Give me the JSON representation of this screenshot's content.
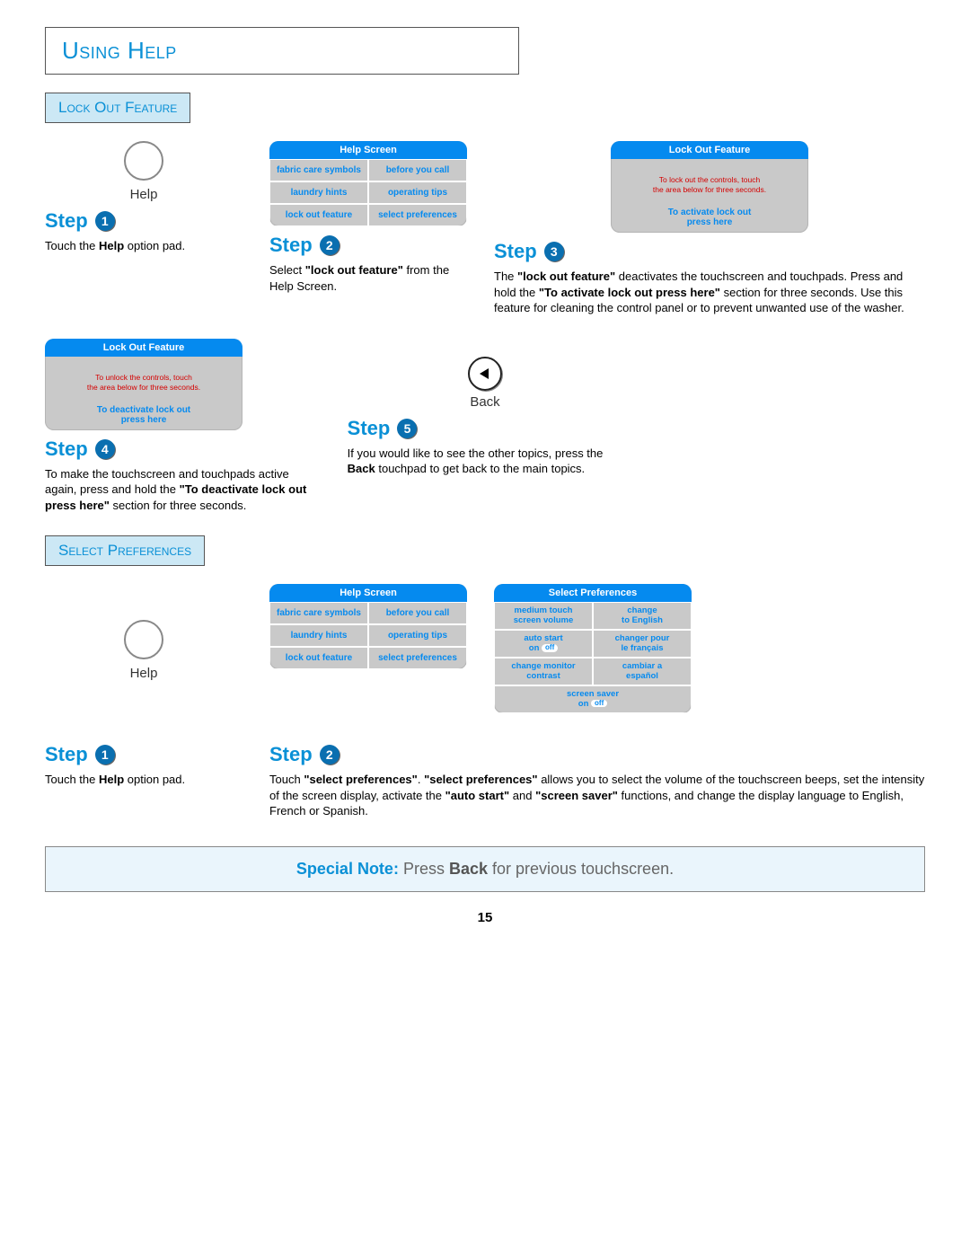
{
  "title": "Using Help",
  "section_a": "Lock Out Feature",
  "section_b": "Select Preferences",
  "help_label": "Help",
  "back_label": "Back",
  "page_number": "15",
  "step_word": "Step",
  "note": {
    "lead": "Special Note:",
    "body_pre": "  Press ",
    "body_bold": "Back",
    "body_post": " for previous touchscreen."
  },
  "steps_a": {
    "s1": "Touch the Help option pad.",
    "s2": "Select \"lock out feature\" from the Help Screen.",
    "s3": "The \"lock out feature\" deactivates the touchscreen and touchpads.  Press and hold the \"To activate lock out press here\" section for three seconds.  Use this feature for cleaning the control panel or to prevent unwanted use of the washer.",
    "s4": "To make the touchscreen and touchpads active again, press and hold the \"To deactivate lock out press here\" section for three seconds.",
    "s5": "If you would like to see the other topics, press the Back touchpad to get back to the main topics."
  },
  "steps_b": {
    "s1": "Touch the Help option pad.",
    "s2": "Touch \"select preferences\".  \"select preferences\" allows you to select the volume of the touchscreen beeps, set the intensity of the screen display, activate the \"auto start\" and \"screen saver\" functions, and change the display language to English, French or Spanish."
  },
  "help_screen": {
    "bar": "Help Screen",
    "cells": [
      "fabric care symbols",
      "before you call",
      "laundry hints",
      "operating tips",
      "lock out feature",
      "select preferences"
    ]
  },
  "lock_screen_activate": {
    "bar": "Lock Out Feature",
    "msg1": "To lock out the controls, touch",
    "msg2": "the area below for three seconds.",
    "footer": "To activate lock out press here"
  },
  "lock_screen_deactivate": {
    "bar": "Lock Out Feature",
    "msg1": "To unlock the controls, touch",
    "msg2": "the area below for three seconds.",
    "footer": "To deactivate lock out press here"
  },
  "pref_screen": {
    "bar": "Select Preferences",
    "cells": [
      "medium touch screen volume",
      "change to English",
      "auto start on off",
      "changer pour le français",
      "change monitor contrast",
      "cambiar a español",
      "screen saver on off"
    ]
  }
}
